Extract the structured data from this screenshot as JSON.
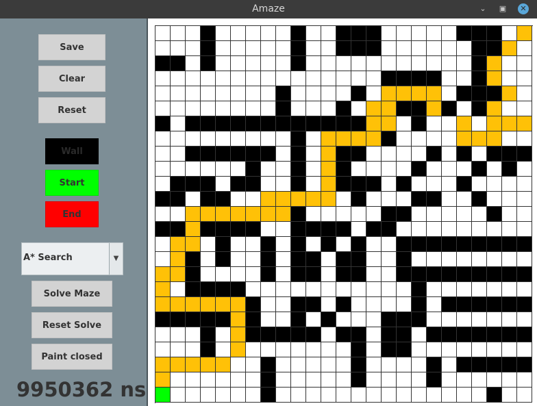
{
  "window": {
    "title": "Amaze"
  },
  "sidebar": {
    "buttons": {
      "save": "Save",
      "clear": "Clear",
      "reset": "Reset",
      "wall": "Wall",
      "start": "Start",
      "end": "End",
      "solve": "Solve Maze",
      "reset_solve": "Reset Solve",
      "paint_closed": "Paint closed"
    },
    "algorithm": {
      "selected": "A* Search"
    },
    "timer": "9950362 ns"
  },
  "colors": {
    "wall": "#000000",
    "path": "#ffc107",
    "start": "#00ff00",
    "end": "#ff0000",
    "empty": "#ffffff"
  },
  "maze": {
    "legend": {
      ".": "empty",
      "#": "wall",
      "o": "path",
      "S": "start",
      "E": "end"
    },
    "rows": [
      "...#.....#..###.....###.oE",
      "...#.....#..###......##o.",
      "##.#.....#...........#o.",
      "...............####..#o.",
      "........#....#.oooo.###o.",
      "........#...#.oo##o#.#o.",
      "#.############oo.#..o.ooo",
      ".........#.oooo#....ooo..",
      "..######.#.o##....#.#.###",
      "......#..#.o#....#...#.#",
      ".###.##..#.o###.#...#....",
      "##.##..ooooo.#...##..#...",
      "..ooooooo#.....##.....#..",
      "##o####..####.##.........",
      ".oo.#..#.#.#.#..#########",
      ".o#.#..#.##.##..#........",
      "oo#....#.##.##..#########",
      "o.####...........#.......",
      "oooooo#..##.#....#.#######",
      "#####o#..#.#...###........",
      "...#.o#####.##.##.#######.",
      "...#.o.......#.##.........",
      "ooooo..#.....#....#.######",
      "o......#.....#....#.......",
      "S......#..............#.."
    ]
  }
}
